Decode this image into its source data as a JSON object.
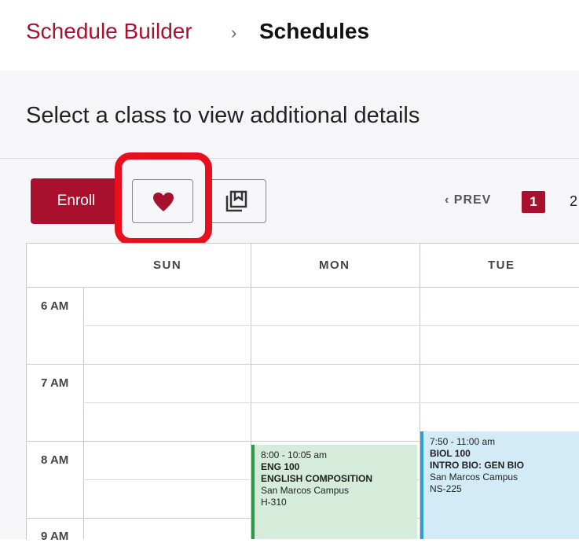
{
  "header": {
    "breadcrumb_link": "Schedule Builder",
    "breadcrumb_separator": "›",
    "breadcrumb_current": "Schedules"
  },
  "main": {
    "subtitle": "Select a class to view additional details",
    "toolbar": {
      "enroll_label": "Enroll",
      "favorite_icon": "heart-icon",
      "save_icon": "bookmark-stack-icon"
    },
    "pagination": {
      "prev_label": "PREV",
      "current_page": "1",
      "next_page": "2"
    }
  },
  "calendar": {
    "days": [
      "SUN",
      "MON",
      "TUE"
    ],
    "times": [
      "6 AM",
      "7 AM",
      "8 AM",
      "9 AM"
    ],
    "events": [
      {
        "time": "8:00 - 10:05 am",
        "code": "ENG 100",
        "title": "ENGLISH COMPOSITION",
        "campus": "San Marcos Campus",
        "room": "H-310"
      },
      {
        "time": "7:50 - 11:00 am",
        "code": "BIOL 100",
        "title": "INTRO BIO: GEN BIO",
        "campus": "San Marcos Campus",
        "room": "NS-225"
      }
    ]
  },
  "colors": {
    "brand": "#a8102e",
    "highlight": "#e8101e",
    "eng_event": "#d4ecd9",
    "bio_event": "#d3ebf7"
  }
}
